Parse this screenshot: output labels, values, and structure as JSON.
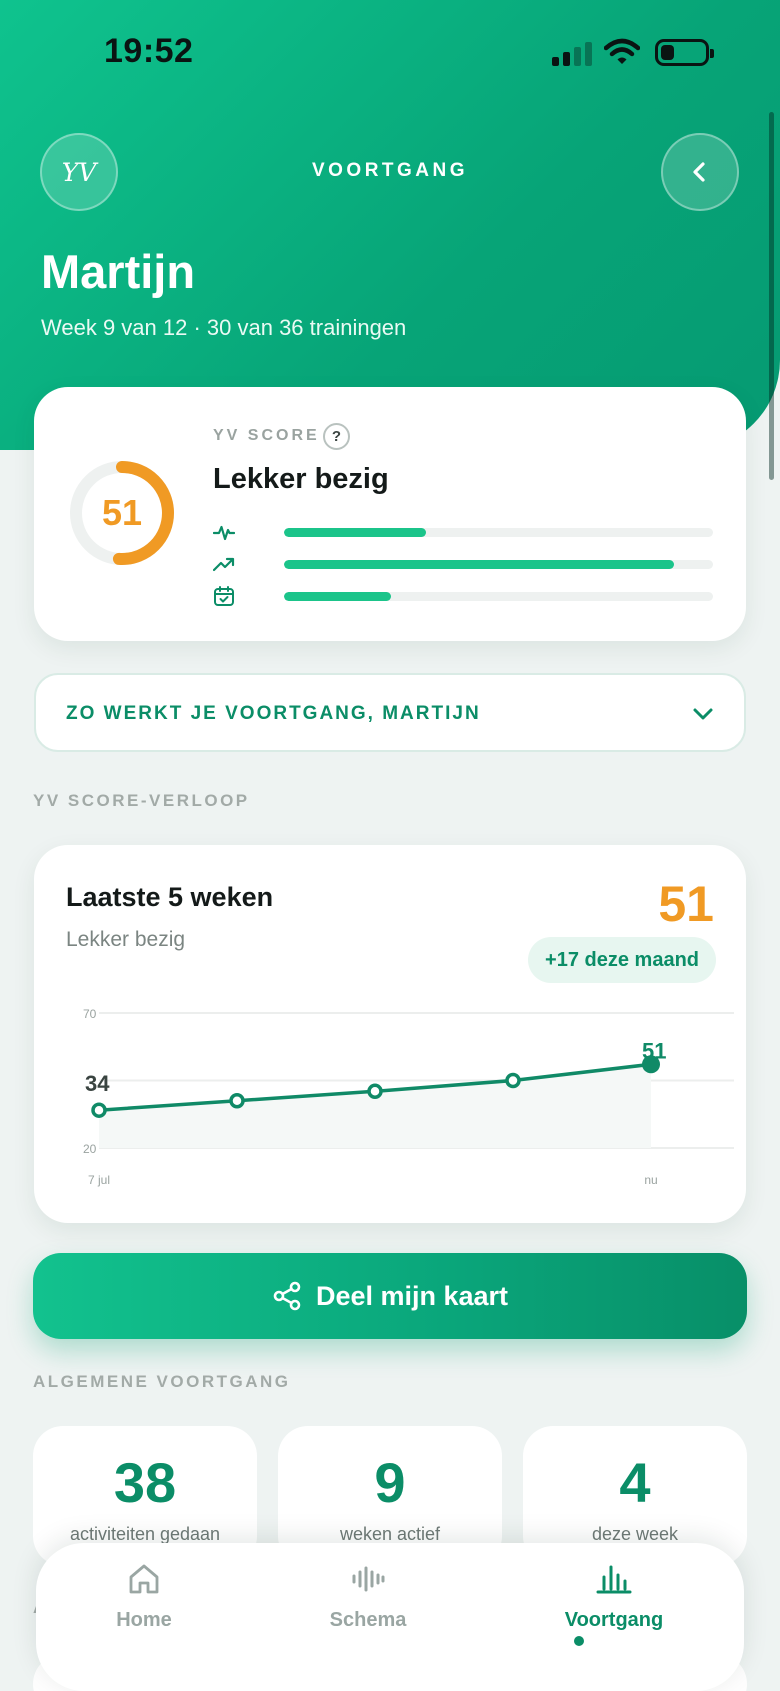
{
  "status_bar": {
    "time": "19:52"
  },
  "header": {
    "logo_text": "YV",
    "title": "VOORTGANG",
    "user_name": "Martijn",
    "subtitle": "Week 9 van 12 · 30 van 36 trainingen"
  },
  "score_card": {
    "label": "YV SCORE",
    "help_symbol": "?",
    "score": "51",
    "score_fraction": 0.51,
    "status": "Lekker bezig",
    "ring_color": "#f09a24",
    "metrics": [
      {
        "icon": "activity-icon",
        "fraction": 0.33
      },
      {
        "icon": "trending-up-icon",
        "fraction": 0.91
      },
      {
        "icon": "calendar-check-icon",
        "fraction": 0.25
      }
    ]
  },
  "explain": {
    "label": "ZO WERKT JE VOORTGANG, MARTIJN"
  },
  "trend_section": {
    "label": "YV SCORE-VERLOOP"
  },
  "trend_card": {
    "title": "Laatste 5 weken",
    "subtitle": "Lekker bezig",
    "current_value": "51",
    "delta_label": "+17 deze maand"
  },
  "chart_data": {
    "type": "line",
    "x_labels": [
      "7 jul",
      "",
      "",
      "",
      "nu"
    ],
    "y_ticks": [
      "70",
      "20"
    ],
    "values": [
      34,
      37.5,
      41,
      45,
      51
    ],
    "ylim": [
      20,
      70
    ],
    "start_label": "34",
    "end_label": "51",
    "line_color": "#108a67"
  },
  "share_button": {
    "label": "Deel mijn kaart"
  },
  "general_section": {
    "label": "ALGEMENE VOORTGANG"
  },
  "stats": [
    {
      "value": "38",
      "label": "activiteiten gedaan"
    },
    {
      "value": "9",
      "label": "weken actief"
    },
    {
      "value": "4",
      "label": "deze week"
    }
  ],
  "tabbar": {
    "tabs": [
      {
        "label": "Home",
        "icon": "home-icon"
      },
      {
        "label": "Schema",
        "icon": "waveform-icon"
      },
      {
        "label": "Voortgang",
        "icon": "bar-chart-icon"
      }
    ],
    "active": "Voortgang"
  },
  "partial_section_letter": "A"
}
